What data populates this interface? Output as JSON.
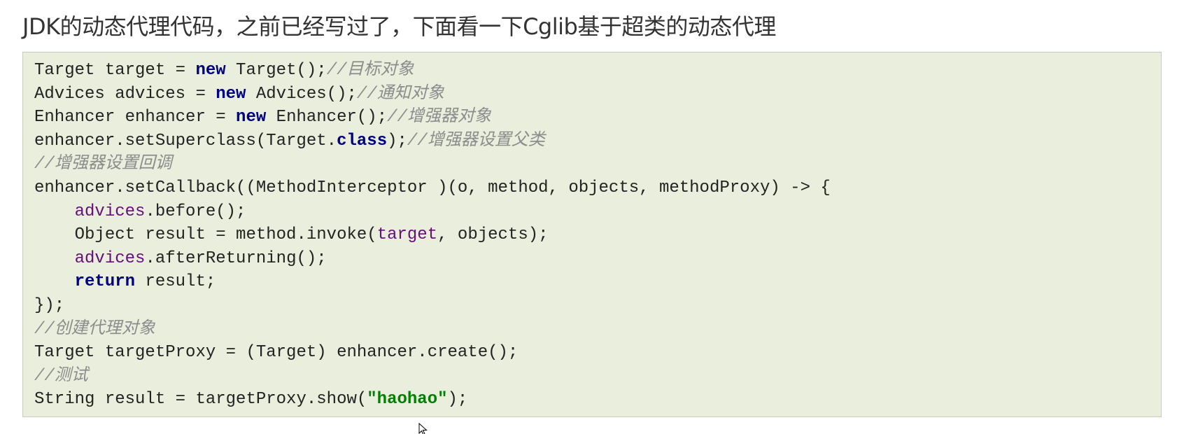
{
  "heading": "JDK的动态代理代码，之前已经写过了，下面看一下Cglib基于超类的动态代理",
  "code": {
    "language": "java",
    "lines": [
      [
        {
          "t": "plain",
          "v": "Target target = "
        },
        {
          "t": "kw",
          "v": "new"
        },
        {
          "t": "plain",
          "v": " Target();"
        },
        {
          "t": "comment",
          "v": "//目标对象"
        }
      ],
      [
        {
          "t": "plain",
          "v": "Advices advices = "
        },
        {
          "t": "kw",
          "v": "new"
        },
        {
          "t": "plain",
          "v": " Advices();"
        },
        {
          "t": "comment",
          "v": "//通知对象"
        }
      ],
      [
        {
          "t": "plain",
          "v": "Enhancer enhancer = "
        },
        {
          "t": "kw",
          "v": "new"
        },
        {
          "t": "plain",
          "v": " Enhancer();"
        },
        {
          "t": "comment",
          "v": "//增强器对象"
        }
      ],
      [
        {
          "t": "plain",
          "v": "enhancer.setSuperclass(Target."
        },
        {
          "t": "kw",
          "v": "class"
        },
        {
          "t": "plain",
          "v": ");"
        },
        {
          "t": "comment",
          "v": "//增强器设置父类"
        }
      ],
      [
        {
          "t": "comment",
          "v": "//增强器设置回调"
        }
      ],
      [
        {
          "t": "plain",
          "v": "enhancer.setCallback((MethodInterceptor )(o, method, objects, methodProxy) -> {"
        }
      ],
      [
        {
          "t": "plain",
          "v": "    "
        },
        {
          "t": "field",
          "v": "advices"
        },
        {
          "t": "plain",
          "v": ".before();"
        }
      ],
      [
        {
          "t": "plain",
          "v": "    Object result = method.invoke("
        },
        {
          "t": "field",
          "v": "target"
        },
        {
          "t": "plain",
          "v": ", objects);"
        }
      ],
      [
        {
          "t": "plain",
          "v": "    "
        },
        {
          "t": "field",
          "v": "advices"
        },
        {
          "t": "plain",
          "v": ".afterReturning();"
        }
      ],
      [
        {
          "t": "plain",
          "v": "    "
        },
        {
          "t": "kw",
          "v": "return"
        },
        {
          "t": "plain",
          "v": " result;"
        }
      ],
      [
        {
          "t": "plain",
          "v": "});"
        }
      ],
      [
        {
          "t": "comment",
          "v": "//创建代理对象"
        }
      ],
      [
        {
          "t": "plain",
          "v": "Target targetProxy = (Target) enhancer.create();"
        }
      ],
      [
        {
          "t": "comment",
          "v": "//测试"
        }
      ],
      [
        {
          "t": "plain",
          "v": "String result = targetProxy.show("
        },
        {
          "t": "string",
          "v": "\"haohao\""
        },
        {
          "t": "plain",
          "v": ");"
        }
      ]
    ]
  },
  "colors": {
    "keyword": "#000080",
    "comment": "#8c8c8c",
    "field": "#660e7a",
    "string": "#008000",
    "code_background": "#e9eedd"
  },
  "cursor_icon": "mouse-pointer-icon"
}
